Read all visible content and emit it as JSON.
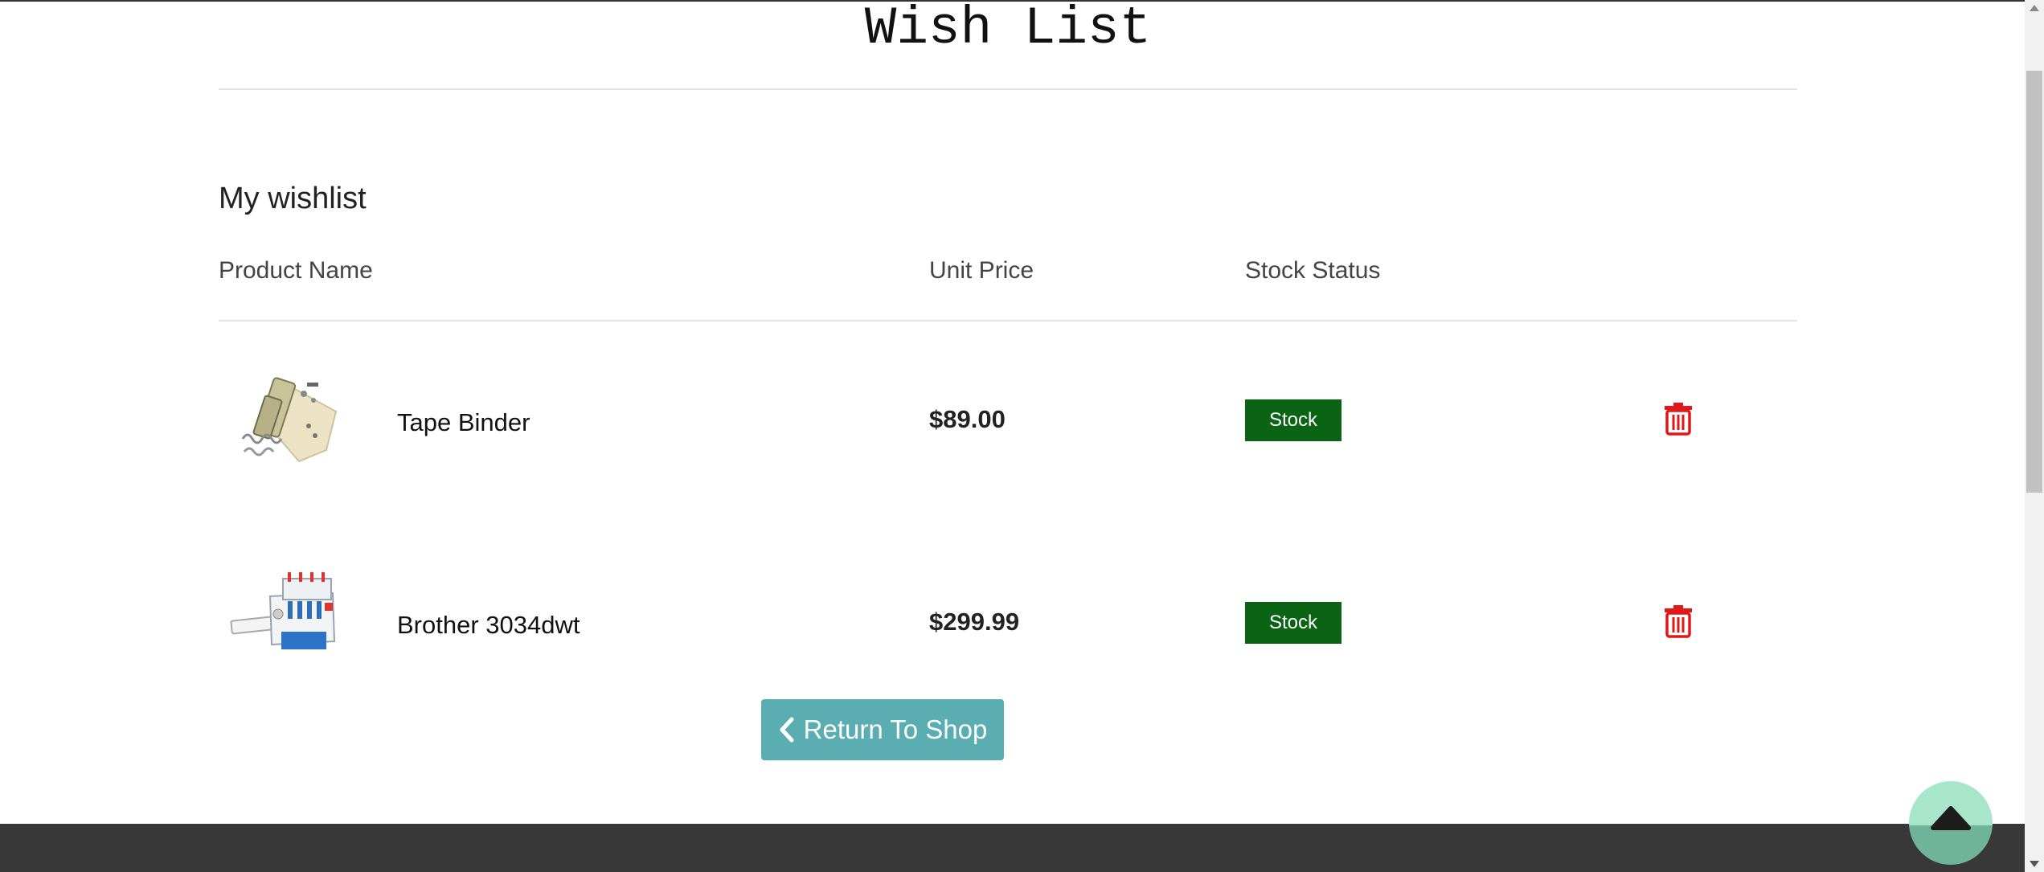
{
  "page": {
    "title": "Wish List"
  },
  "wishlist": {
    "heading": "My wishlist",
    "columns": {
      "product_name": "Product Name",
      "unit_price": "Unit Price",
      "stock_status": "Stock Status"
    },
    "items": [
      {
        "name": "Tape Binder",
        "price": "$89.00",
        "stock": "Stock",
        "image_icon": "tape-binder-attachment"
      },
      {
        "name": "Brother 3034dwt",
        "price": "$299.99",
        "stock": "Stock",
        "image_icon": "serger-machine"
      }
    ],
    "return_button": "Return To Shop"
  },
  "colors": {
    "stock_badge": "#0b6414",
    "delete_icon": "#e01818",
    "return_button": "#5aaeb2",
    "footer": "#383838",
    "back_to_top": "#a8e6cc"
  }
}
